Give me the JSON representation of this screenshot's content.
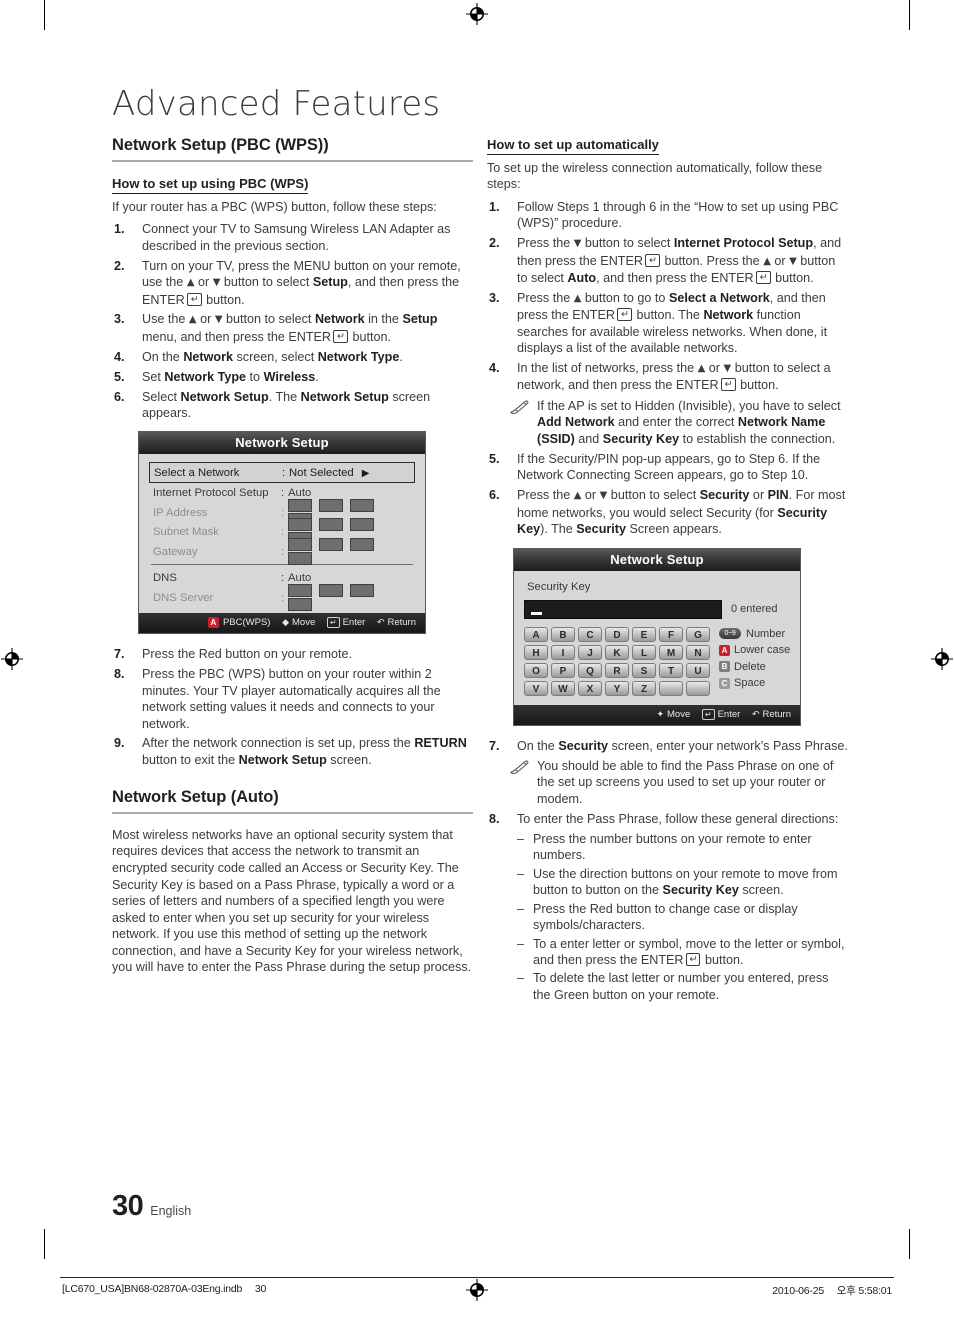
{
  "page": {
    "title": "Advanced Features",
    "number": "30",
    "language": "English"
  },
  "left_column": {
    "section_heading": "Network Setup (PBC (WPS))",
    "sub_heading": "How to set up using PBC (WPS)",
    "intro": "If your router has a PBC (WPS) button, follow these steps:",
    "steps": [
      {
        "num": "1.",
        "html": "Connect your TV to Samsung Wireless LAN Adapter as described in the previous section."
      },
      {
        "num": "2.",
        "html": "Turn on your TV, press the MENU button on your remote, use the <span class=\"arrow-up\">&#9650;</span> or <span class=\"arrow-dn\">&#9660;</span> button to select <b>Setup</b>, and then press the ENTER<span class=\"enterkey\">&#8629;</span> button."
      },
      {
        "num": "3.",
        "html": "Use the <span class=\"arrow-up\">&#9650;</span> or <span class=\"arrow-dn\">&#9660;</span> button to select <b>Network</b> in the <b>Setup</b> menu, and then press the ENTER<span class=\"enterkey\">&#8629;</span> button."
      },
      {
        "num": "4.",
        "html": "On the <b>Network</b> screen, select <b>Network Type</b>."
      },
      {
        "num": "5.",
        "html": "Set <b>Network Type</b> to <b>Wireless</b>."
      },
      {
        "num": "6.",
        "html": "Select <b>Network Setup</b>. The <b>Network Setup</b> screen appears."
      }
    ],
    "steps_after": [
      {
        "num": "7.",
        "html": "Press the Red button on your remote."
      },
      {
        "num": "8.",
        "html": "Press the PBC (WPS) button on your router within 2 minutes. Your TV player automatically acquires all the network setting values it needs and connects to your network."
      },
      {
        "num": "9.",
        "html": "After the network connection is set up, press the <b>RETURN</b> button to exit the <b>Network Setup</b> screen."
      }
    ],
    "auto_heading": "Network Setup (Auto)",
    "auto_paragraph": "Most wireless networks have an optional security system that requires devices that access the network to transmit an encrypted security code called an Access or Security Key. The Security Key is based on a Pass Phrase, typically a word or a series of letters and numbers of a specified length you were asked to enter when you set up security for your wireless network.  If you use this method of setting up the network connection, and have a Security Key for your wireless network, you will have to enter the Pass Phrase during the setup process."
  },
  "network_setup_osd": {
    "title": "Network Setup",
    "rows": [
      {
        "label": "Select a Network",
        "sep": ":",
        "value": "Not Selected",
        "type": "text",
        "selected": true,
        "arrow": "▶"
      },
      {
        "label": "Internet Protocol Setup",
        "sep": ":",
        "value": "Auto",
        "type": "text",
        "selected": false
      },
      {
        "label": "IP Address",
        "sep": ":",
        "value": "",
        "type": "boxes",
        "boxes": 4,
        "dim": true
      },
      {
        "label": "Subnet Mask",
        "sep": ":",
        "value": "",
        "type": "boxes",
        "boxes": 4,
        "dim": true
      },
      {
        "label": "Gateway",
        "sep": ":",
        "value": "",
        "type": "boxes",
        "boxes": 4,
        "dim": true
      },
      {
        "label": "DNS",
        "sep": ":",
        "value": "Auto",
        "type": "text",
        "divider_before": true
      },
      {
        "label": "DNS Server",
        "sep": ":",
        "value": "",
        "type": "boxes",
        "boxes": 4,
        "dim": true
      }
    ],
    "footer": [
      {
        "icon": "red-a-button",
        "label": "PBC(WPS)"
      },
      {
        "icon": "updown-arrows",
        "label": "Move"
      },
      {
        "icon": "enter-key",
        "label": "Enter"
      },
      {
        "icon": "return-arrow",
        "label": "Return"
      }
    ]
  },
  "right_column": {
    "sub_heading": "How to set up automatically",
    "intro": "To set up the wireless connection automatically, follow these steps:",
    "steps": [
      {
        "num": "1.",
        "html": "Follow Steps 1 through 6 in the “How to set up using PBC (WPS)” procedure."
      },
      {
        "num": "2.",
        "html": "Press the <span class=\"arrow-dn\">&#9660;</span> button to select <b>Internet Protocol Setup</b>, and then press the ENTER<span class=\"enterkey\">&#8629;</span> button. Press the <span class=\"arrow-up\">&#9650;</span> or <span class=\"arrow-dn\">&#9660;</span> button to select <b>Auto</b>, and then press the ENTER<span class=\"enterkey\">&#8629;</span> button."
      },
      {
        "num": "3.",
        "html": "Press the <span class=\"arrow-up\">&#9650;</span> button to go to <b>Select a Network</b>, and then press the ENTER<span class=\"enterkey\">&#8629;</span> button. The <b>Network</b> function searches for available wireless networks. When done, it displays a list of the available networks."
      },
      {
        "num": "4.",
        "html": "In the list of networks, press the <span class=\"arrow-up\">&#9650;</span> or <span class=\"arrow-dn\">&#9660;</span> button to select a network, and then press the ENTER<span class=\"enterkey\">&#8629;</span> button."
      }
    ],
    "note_after_4": "If the AP is set to Hidden (Invisible), you have to select <b>Add Network</b> and enter the correct <b>Network Name (SSID)</b> and <b>Security Key</b> to establish the connection.",
    "steps_2": [
      {
        "num": "5.",
        "html": "If the Security/PIN pop-up appears, go to Step 6. If the Network Connecting Screen appears, go to Step 10."
      },
      {
        "num": "6.",
        "html": "Press the <span class=\"arrow-up\">&#9650;</span> or <span class=\"arrow-dn\">&#9660;</span> button to select <b>Security</b> or <b>PIN</b>. For most home networks, you would select Security (for <b>Security Key</b>). The <b>Security</b> Screen appears."
      }
    ],
    "step_7": {
      "num": "7.",
      "html": "On the <b>Security</b> screen, enter your network’s Pass Phrase."
    },
    "note_after_7": "You should be able to find the Pass Phrase on one of the set up screens you used to set up your router or modem.",
    "step_8": {
      "num": "8.",
      "html": "To enter the Pass Phrase, follow these general directions:"
    },
    "dash_items": [
      "Press the number buttons on your remote to enter numbers.",
      "Use the direction buttons on your remote to move from button to button on the <b>Security Key</b> screen.",
      "Press the Red button to change case or display symbols/characters.",
      "To a enter letter or symbol, move to the letter or symbol, and then press the ENTER<span class=\"enterkey\">&#8629;</span> button.",
      "To delete the last letter or number you entered, press the Green button on your remote."
    ]
  },
  "security_key_osd": {
    "title": "Network Setup",
    "field_label": "Security Key",
    "input_value": "",
    "entered_text": "0 entered",
    "key_rows": [
      [
        "A",
        "B",
        "C",
        "D",
        "E",
        "F",
        "G"
      ],
      [
        "H",
        "I",
        "J",
        "K",
        "L",
        "M",
        "N"
      ],
      [
        "O",
        "P",
        "Q",
        "R",
        "S",
        "T",
        "U"
      ],
      [
        "V",
        "W",
        "X",
        "Y",
        "Z",
        "",
        ""
      ]
    ],
    "legend": [
      {
        "btn": "0~9",
        "btn_kind": "number",
        "label": "Number"
      },
      {
        "btn": "A",
        "btn_kind": "red",
        "label": "Lower case"
      },
      {
        "btn": "B",
        "btn_kind": "green",
        "label": "Delete"
      },
      {
        "btn": "C",
        "btn_kind": "blue",
        "label": "Space"
      }
    ],
    "footer": [
      {
        "icon": "dpad-arrows",
        "label": "Move"
      },
      {
        "icon": "enter-key",
        "label": "Enter"
      },
      {
        "icon": "return-arrow",
        "label": "Return"
      }
    ]
  },
  "footer": {
    "file_name": "[LC670_USA]BN68-02870A-03Eng.indb",
    "file_page": "30",
    "date": "2010-06-25",
    "time": "오후 5:58:01"
  },
  "colors": {
    "accent_red": "#c8202a",
    "rule_gray": "#a7a9ac",
    "text": "#3c3c3e",
    "heading": "#231f20"
  }
}
